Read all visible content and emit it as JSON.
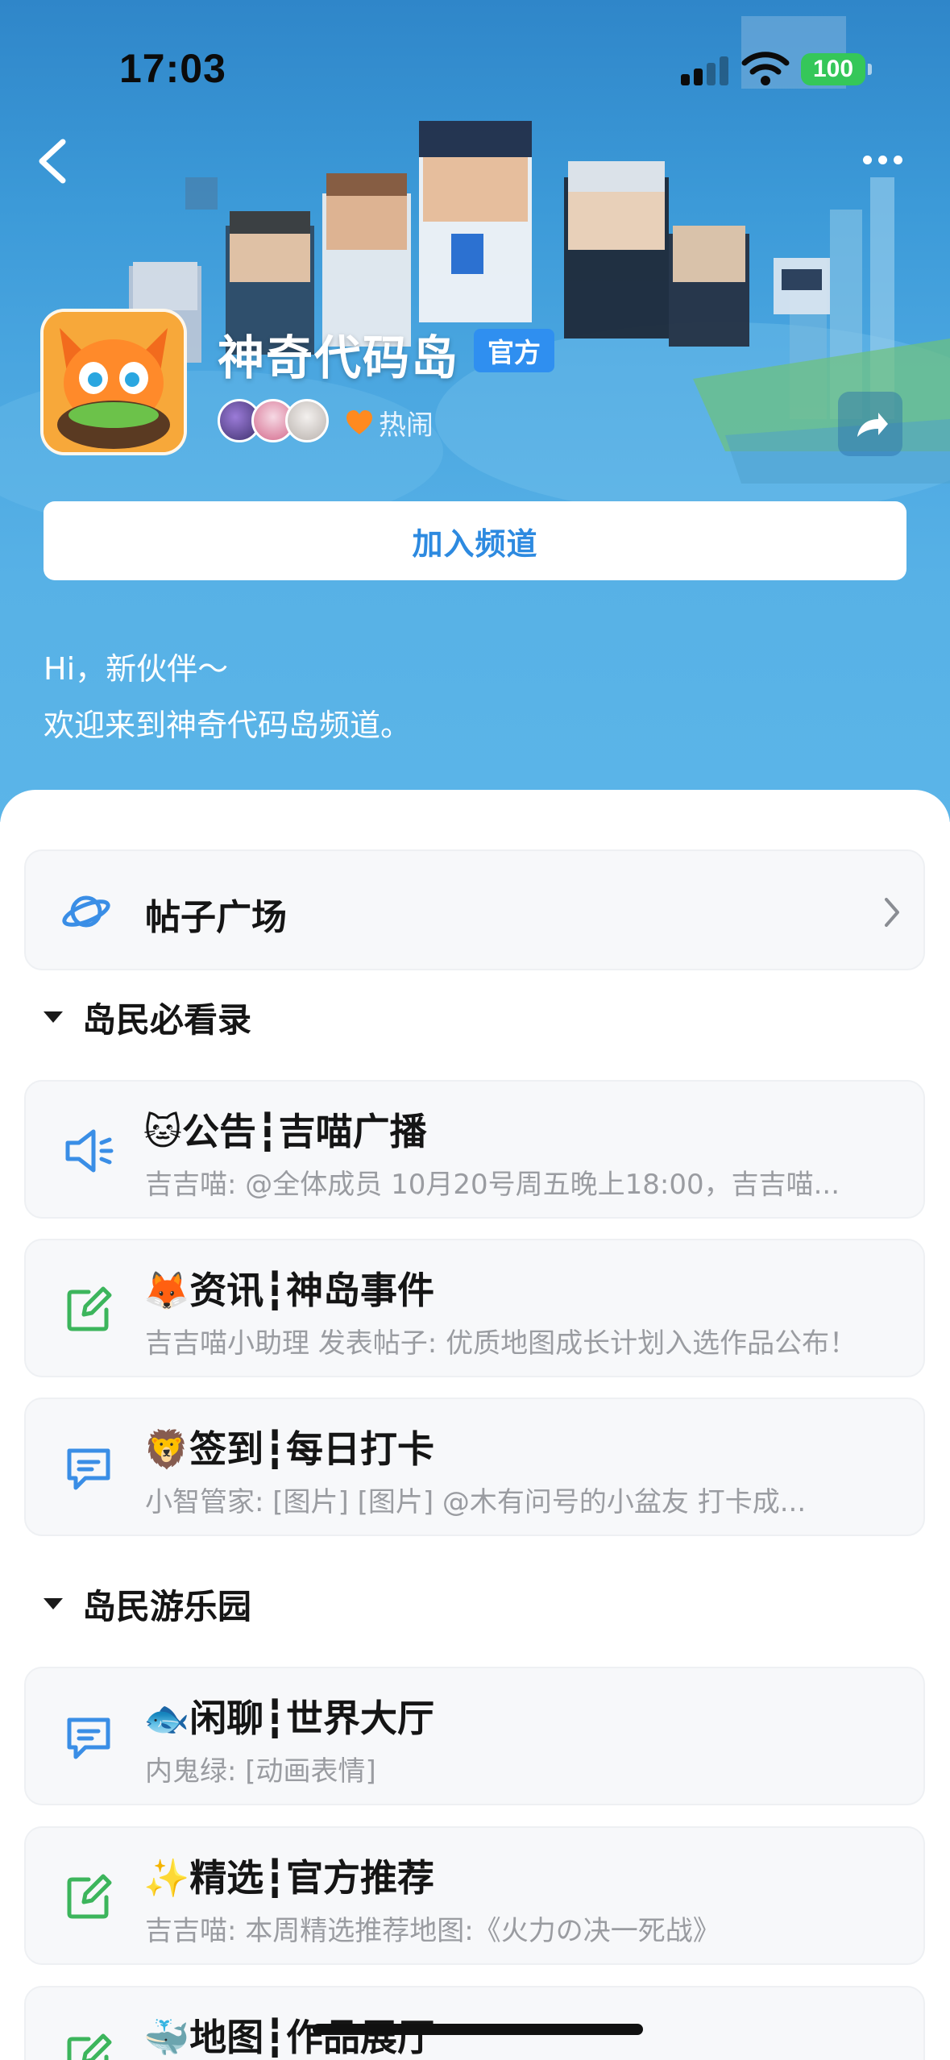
{
  "status_bar": {
    "time": "17:03",
    "battery": "100"
  },
  "header": {
    "channel_name": "神奇代码岛",
    "official_badge": "官方",
    "activity_label": "热闹",
    "join_button": "加入频道",
    "welcome_line1": "Hi，新伙伴～",
    "welcome_line2": "欢迎来到神奇代码岛频道。"
  },
  "plaza": {
    "label": "帖子广场"
  },
  "sections": [
    {
      "label": "岛民必看录",
      "channels": [
        {
          "title": "🐱公告┇吉喵广播",
          "subtitle": "吉吉喵: @全体成员 10月20号周五晚上18:00，吉吉喵...",
          "icon": "megaphone-icon"
        },
        {
          "title": "🦊资讯┇神岛事件",
          "subtitle": "吉吉喵小助理 发表帖子: 优质地图成长计划入选作品公布！",
          "icon": "edit-icon"
        },
        {
          "title": "🦁签到┇每日打卡",
          "subtitle": "小智管家: [图片] [图片] @木有问号的小盆友 打卡成...",
          "icon": "chat-icon"
        }
      ]
    },
    {
      "label": "岛民游乐园",
      "channels": [
        {
          "title": "🐟闲聊┇世界大厅",
          "subtitle": "内鬼绿: [动画表情]",
          "icon": "chat-icon"
        },
        {
          "title": "✨精选┇官方推荐",
          "subtitle": "吉吉喵: 本周精选推荐地图:《火力の决一死战》",
          "icon": "edit-icon"
        },
        {
          "title": "🐳地图┇作品展厅",
          "subtitle": "",
          "icon": "edit-icon"
        }
      ]
    }
  ],
  "colors": {
    "accent": "#2d8ae0",
    "banner_top": "#2f86c9",
    "banner_bottom": "#5bb5e8",
    "edit_icon": "#3cb55c",
    "chat_icon": "#3a8ee6"
  }
}
